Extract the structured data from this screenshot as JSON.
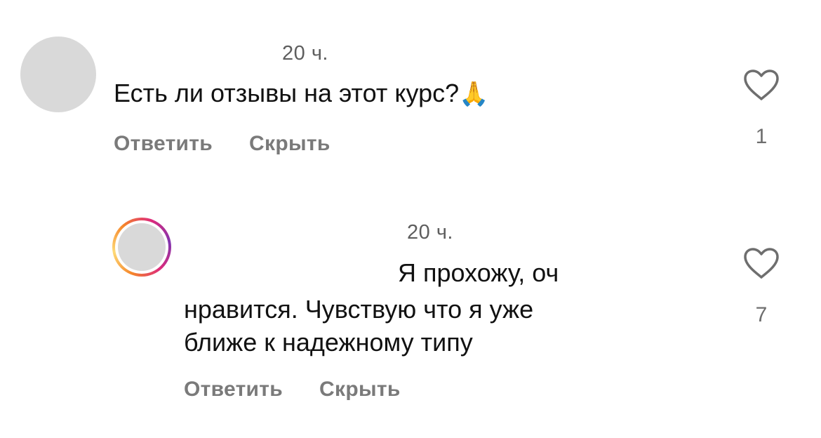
{
  "comments": [
    {
      "time": "20 ч.",
      "text": "Есть ли отзывы на этот курс?",
      "emoji": "🙏",
      "reply_label": "Ответить",
      "hide_label": "Скрыть",
      "likes": "1",
      "has_story_ring": false
    },
    {
      "time": "20 ч.",
      "text_line1": "Я прохожу, оч",
      "text_line2": "нравится. Чувствую что я уже",
      "text_line3": "ближе к надежному типу",
      "reply_label": "Ответить",
      "hide_label": "Скрыть",
      "likes": "7",
      "has_story_ring": true
    }
  ],
  "icons": {
    "like": "heart-outline-icon",
    "ring_colors": [
      "#f58529",
      "#feda77",
      "#dd2a7b",
      "#8134af"
    ]
  }
}
